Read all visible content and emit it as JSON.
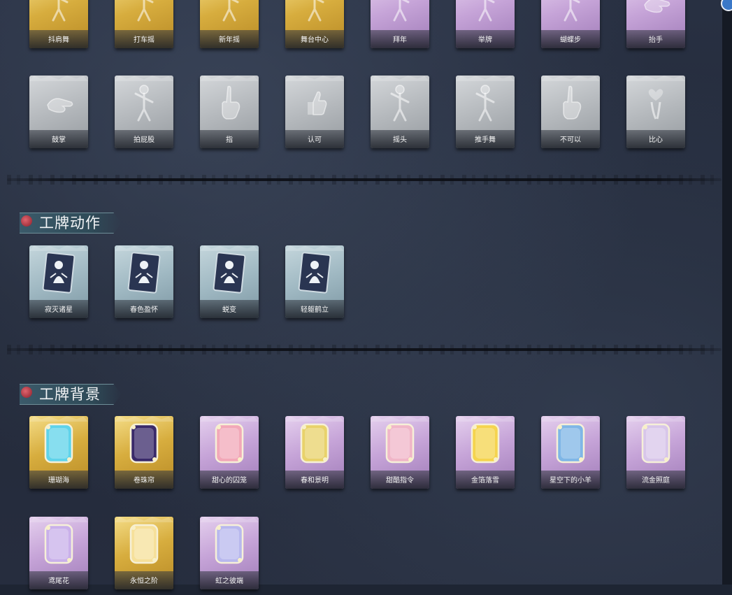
{
  "sections": {
    "top_row_1": [
      {
        "label": "抖肩舞",
        "theme": "gold",
        "icon": "dancer-icon"
      },
      {
        "label": "打车摇",
        "theme": "gold",
        "icon": "dancer-icon"
      },
      {
        "label": "新年摇",
        "theme": "gold",
        "icon": "dancer-icon"
      },
      {
        "label": "舞台中心",
        "theme": "gold",
        "icon": "dancer-icon"
      },
      {
        "label": "拜年",
        "theme": "purple",
        "icon": "figure-icon"
      },
      {
        "label": "举牌",
        "theme": "purple",
        "icon": "figure-icon"
      },
      {
        "label": "蝴蝶步",
        "theme": "purple",
        "icon": "dancer-icon"
      },
      {
        "label": "抬手",
        "theme": "purple",
        "icon": "hand-icon"
      }
    ],
    "top_row_2": [
      {
        "label": "鼓掌",
        "theme": "gray",
        "icon": "clap-icon"
      },
      {
        "label": "拍屁股",
        "theme": "gray",
        "icon": "figure-icon"
      },
      {
        "label": "指",
        "theme": "gray",
        "icon": "point-icon"
      },
      {
        "label": "认可",
        "theme": "gray",
        "icon": "thumbs-up-icon"
      },
      {
        "label": "摇头",
        "theme": "gray",
        "icon": "figure-icon"
      },
      {
        "label": "推手舞",
        "theme": "gray",
        "icon": "figure-icon"
      },
      {
        "label": "不可以",
        "theme": "gray",
        "icon": "finger-icon"
      },
      {
        "label": "比心",
        "theme": "gray",
        "icon": "heart-hand-icon"
      }
    ]
  },
  "badge_actions": {
    "title": "工牌动作",
    "items": [
      {
        "label": "寂灭诸星",
        "theme": "teal",
        "icon": "badge-figure-icon"
      },
      {
        "label": "春色盈怀",
        "theme": "teal",
        "icon": "badge-figure-icon"
      },
      {
        "label": "蜕变",
        "theme": "teal",
        "icon": "badge-figure-icon"
      },
      {
        "label": "轻躯鹤立",
        "theme": "teal",
        "icon": "badge-figure-icon"
      }
    ]
  },
  "badge_backgrounds": {
    "title": "工牌背景",
    "row1": [
      {
        "label": "珊瑚海",
        "theme": "gold",
        "icon": "card-frame-icon",
        "color": "#5fd3ea"
      },
      {
        "label": "卷珠帘",
        "theme": "gold",
        "icon": "card-frame-icon",
        "color": "#3a2a6a"
      },
      {
        "label": "甜心的囚笼",
        "theme": "purple",
        "icon": "card-frame-icon",
        "color": "#f2a8b8"
      },
      {
        "label": "春和景明",
        "theme": "purple",
        "icon": "card-frame-icon",
        "color": "#e8d26a"
      },
      {
        "label": "甜酷指令",
        "theme": "purple",
        "icon": "card-frame-icon",
        "color": "#f0b6c8"
      },
      {
        "label": "金箔落雪",
        "theme": "purple",
        "icon": "card-frame-icon",
        "color": "#f5d44e"
      },
      {
        "label": "星空下的小羊",
        "theme": "purple",
        "icon": "card-frame-icon",
        "color": "#7fb6e6"
      },
      {
        "label": "流金照庭",
        "theme": "purple",
        "icon": "card-frame-icon",
        "color": "#d8c6ea"
      }
    ],
    "row2": [
      {
        "label": "鸢尾花",
        "theme": "purple",
        "icon": "card-frame-icon",
        "color": "#c9b0ea"
      },
      {
        "label": "永恒之阶",
        "theme": "gold",
        "icon": "card-frame-icon",
        "color": "#f6e09a"
      },
      {
        "label": "虹之彼端",
        "theme": "purple",
        "icon": "card-frame-icon",
        "color": "#b8b8ee"
      }
    ]
  }
}
